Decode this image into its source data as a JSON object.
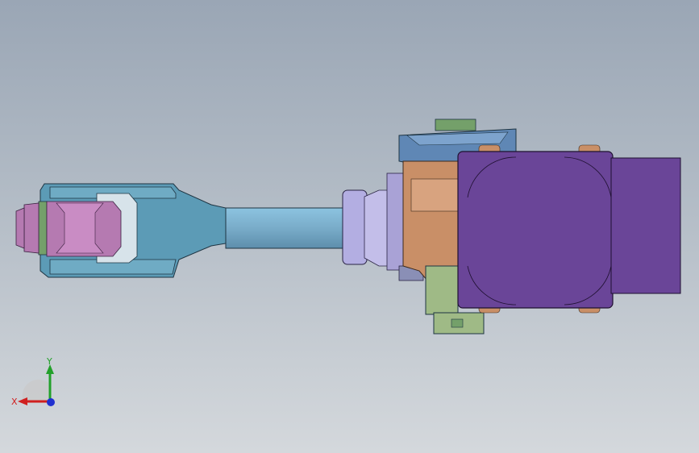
{
  "viewport": {
    "background_top": "#9aa6b5",
    "background_bottom": "#d4d8dc"
  },
  "model": {
    "parts": [
      "clevis-fork",
      "clevis-pin",
      "shaft",
      "shaft-flange",
      "joint-housing",
      "gearbox-block",
      "motor-top-housing",
      "motor-bottom-housing",
      "servo-motor"
    ],
    "colors": {
      "clevis": "#5c9bb6",
      "pin": "#b57ab1",
      "shaft": "#7fb3d2",
      "flange": "#b3aee2",
      "housing": "#b3aee2",
      "gearbox": "#c98f67",
      "motor_top": "#5f87b5",
      "motor_bottom": "#9fba86",
      "servo": "#6a4598",
      "accent_green": "#74a06a"
    }
  },
  "triad": {
    "x_label": "X",
    "y_label": "Y",
    "x_color": "#d02020",
    "y_color": "#22a02a",
    "z_color": "#2030d0"
  }
}
